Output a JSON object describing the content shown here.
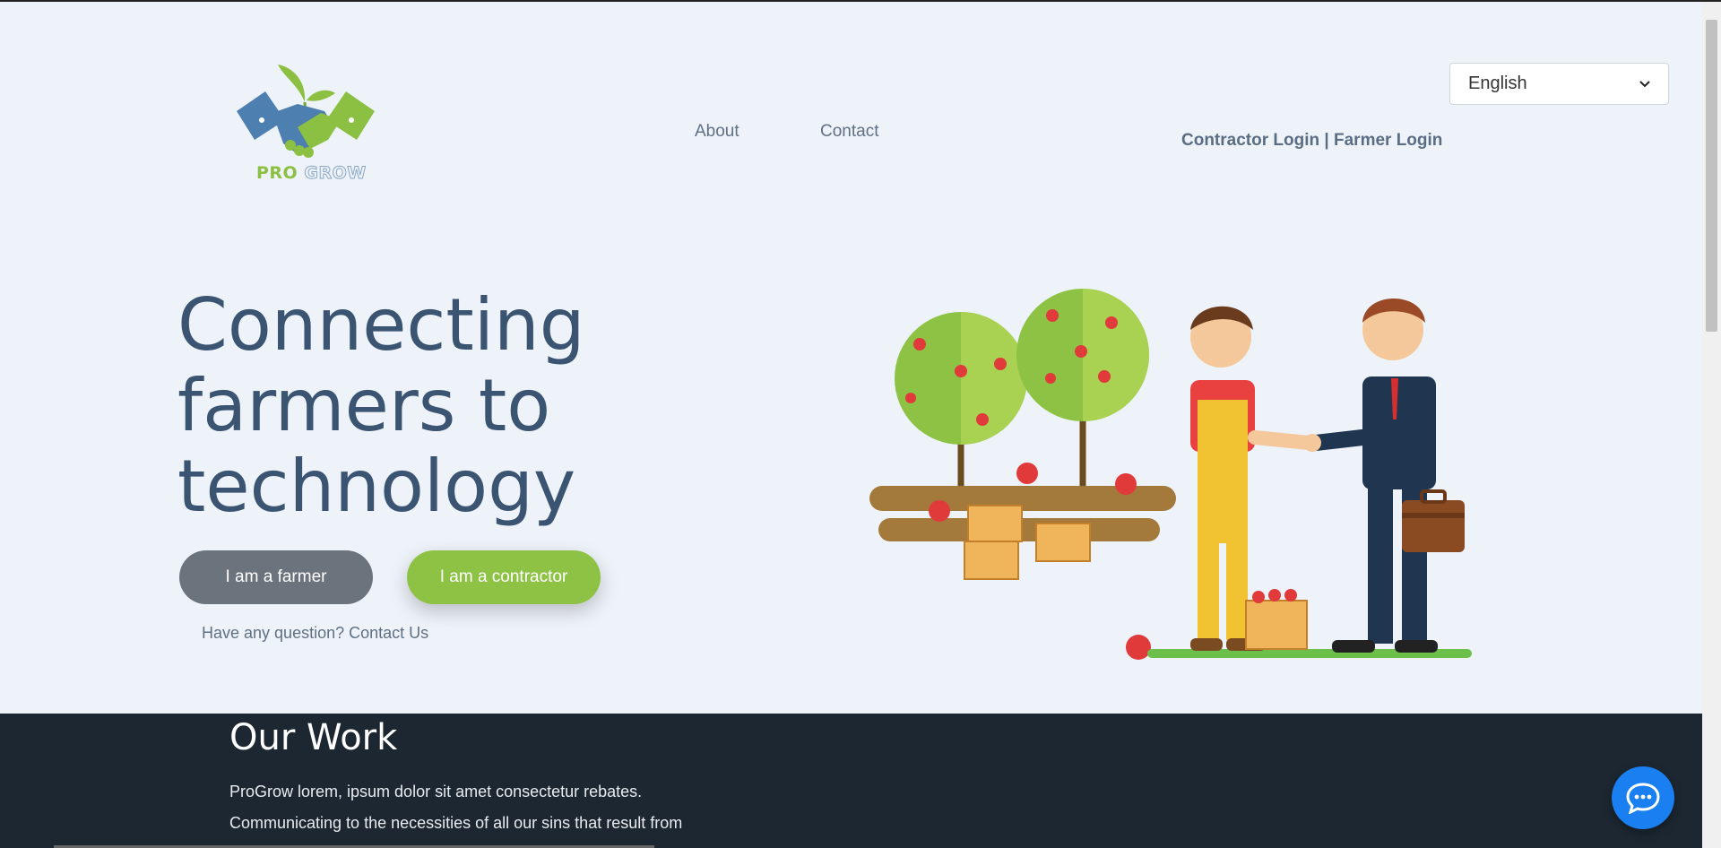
{
  "header": {
    "logo": {
      "pro": "PRO",
      "grow": "GROW"
    },
    "nav": {
      "about": "About",
      "contact": "Contact"
    },
    "login": {
      "contractor": "Contractor Login",
      "separator": "|",
      "farmer": "Farmer Login"
    },
    "language": {
      "selected": "English"
    }
  },
  "hero": {
    "title_line1": "Connecting",
    "title_line2": "farmers to",
    "title_line3": "technology",
    "farmer_button": "I am a farmer",
    "contractor_button": "I am a contractor",
    "question": "Have any question? Contact Us"
  },
  "our_work": {
    "title": "Our Work",
    "text": "ProGrow lorem, ipsum dolor sit amet consectetur rebates. Communicating to the necessities of all our sins that result from"
  },
  "colors": {
    "accent_green": "#8ec245",
    "primary_blue": "#3a5472",
    "dark_section": "#1c2731",
    "chat_blue": "#1a7ff0"
  },
  "icons": {
    "chat": "chat-bubble-icon",
    "dropdown": "chevron-down-icon"
  }
}
